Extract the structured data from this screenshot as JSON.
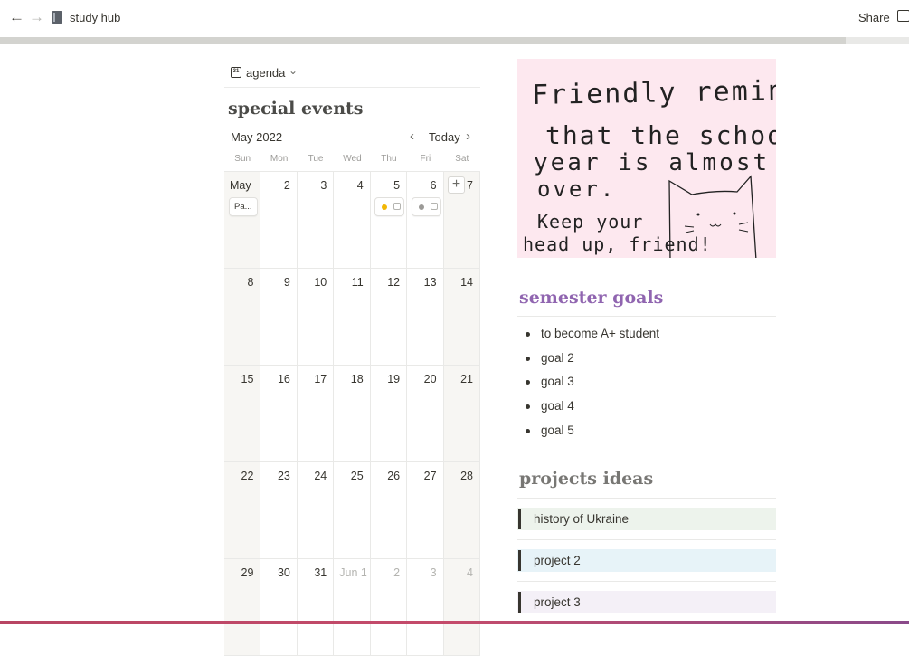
{
  "topbar": {
    "back_icon": "arrow-left-icon",
    "forward_icon": "arrow-right-icon",
    "page_icon": "notebook-icon",
    "page_title": "study hub",
    "share_label": "Share",
    "comments_icon": "comment-icon"
  },
  "progress": {
    "fraction": 0.93
  },
  "calendar": {
    "view_label": "agenda",
    "view_icon_text": "31",
    "title": "special events",
    "month_label": "May 2022",
    "today_label": "Today",
    "weekdays": [
      "Sun",
      "Mon",
      "Tue",
      "Wed",
      "Thu",
      "Fri",
      "Sat"
    ],
    "weeks": [
      [
        "May",
        "2",
        "3",
        "4",
        "5",
        "6",
        "7"
      ],
      [
        "8",
        "9",
        "10",
        "11",
        "12",
        "13",
        "14"
      ],
      [
        "15",
        "16",
        "17",
        "18",
        "19",
        "20",
        "21"
      ],
      [
        "22",
        "23",
        "24",
        "25",
        "26",
        "27",
        "28"
      ],
      [
        "29",
        "30",
        "31",
        "Jun 1",
        "2",
        "3",
        "4"
      ]
    ],
    "events": {
      "sun_event_label": "Pa...",
      "thu_event_color": "#f2b705",
      "fri_event_color": "#9b9a97"
    }
  },
  "reminder": {
    "line1": "Friendly reminder",
    "line2": "that the school",
    "line3": "year is almost",
    "line4": "over.",
    "line5": "Keep your",
    "line6": "head up, friend!"
  },
  "goals": {
    "title": "semester goals",
    "items": [
      "to become A+ student",
      "goal 2",
      "goal 3",
      "goal 4",
      "goal 5"
    ]
  },
  "projects": {
    "title": "projects ideas",
    "items": [
      {
        "label": "history of Ukraine",
        "bg": "#edf3ec"
      },
      {
        "label": "project 2",
        "bg": "#e7f3f8"
      },
      {
        "label": "project 3",
        "bg": "#f4f0f7"
      }
    ]
  }
}
